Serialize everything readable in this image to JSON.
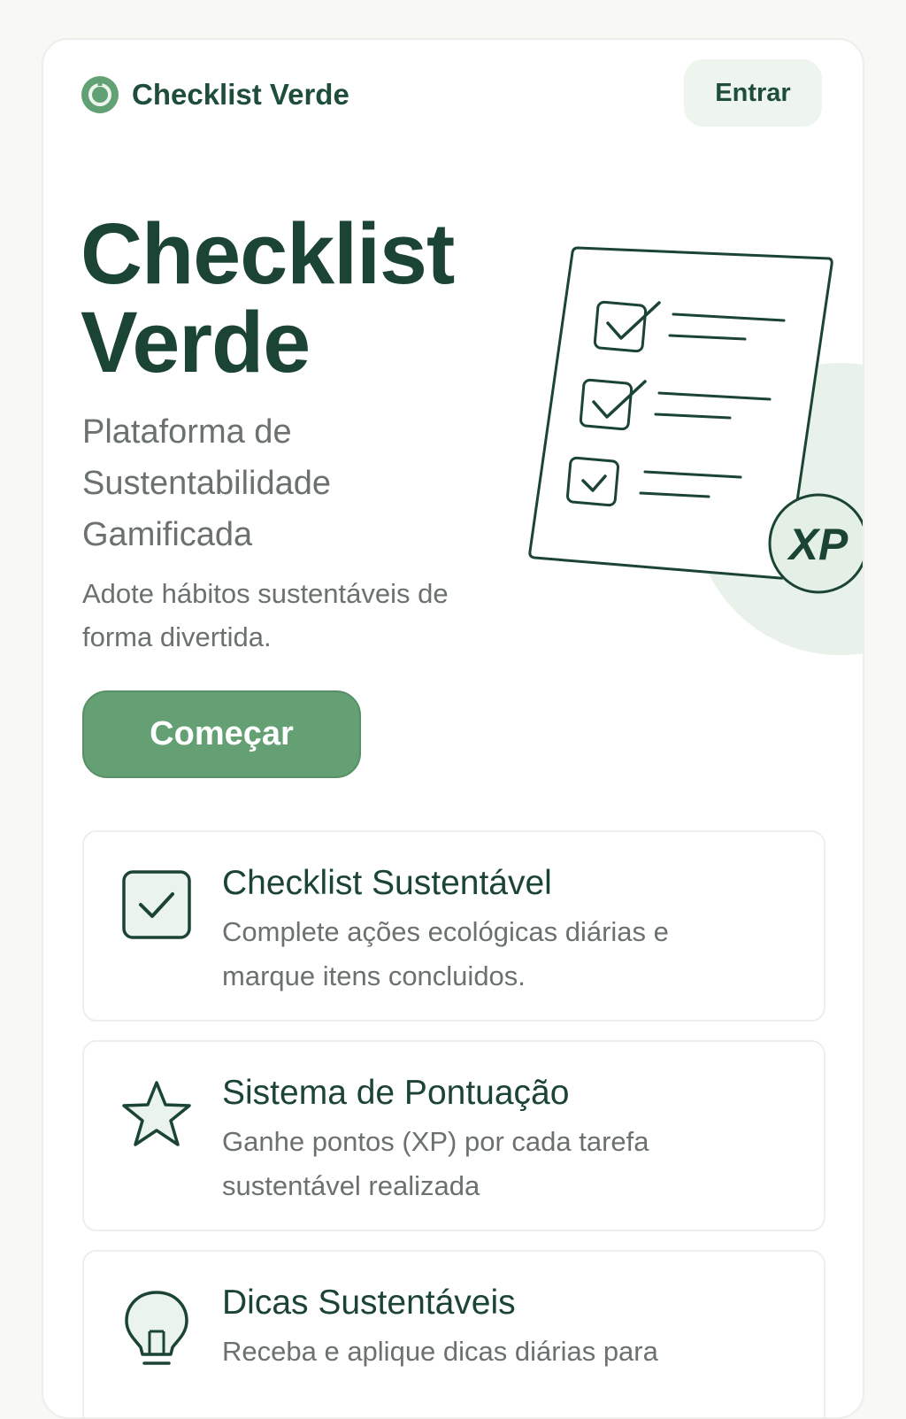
{
  "header": {
    "brand": "Checklist Verde",
    "login_label": "Entrar"
  },
  "hero": {
    "title": "Checklist Verde",
    "subtitle": "Plataforma de Sustentabilidade Gamificada",
    "description": "Adote hábitos sustentáveis de forma divertida.",
    "cta_label": "Começar",
    "badge": "XP"
  },
  "features": [
    {
      "icon": "checkbox-icon",
      "title": "Checklist Sustentável",
      "description": "Complete ações ecológicas diárias e marque itens concluidos."
    },
    {
      "icon": "star-icon",
      "title": "Sistema de Pontuação",
      "description": "Ganhe pontos (XP) por cada tarefa sustentável realizada"
    },
    {
      "icon": "lightbulb-icon",
      "title": "Dicas Sustentáveis",
      "description": "Receba e aplique dicas diárias para"
    }
  ],
  "colors": {
    "primary": "#64a073",
    "dark_green": "#1b4434",
    "light_green": "#eef4ee",
    "muted_text": "#6b716e"
  }
}
